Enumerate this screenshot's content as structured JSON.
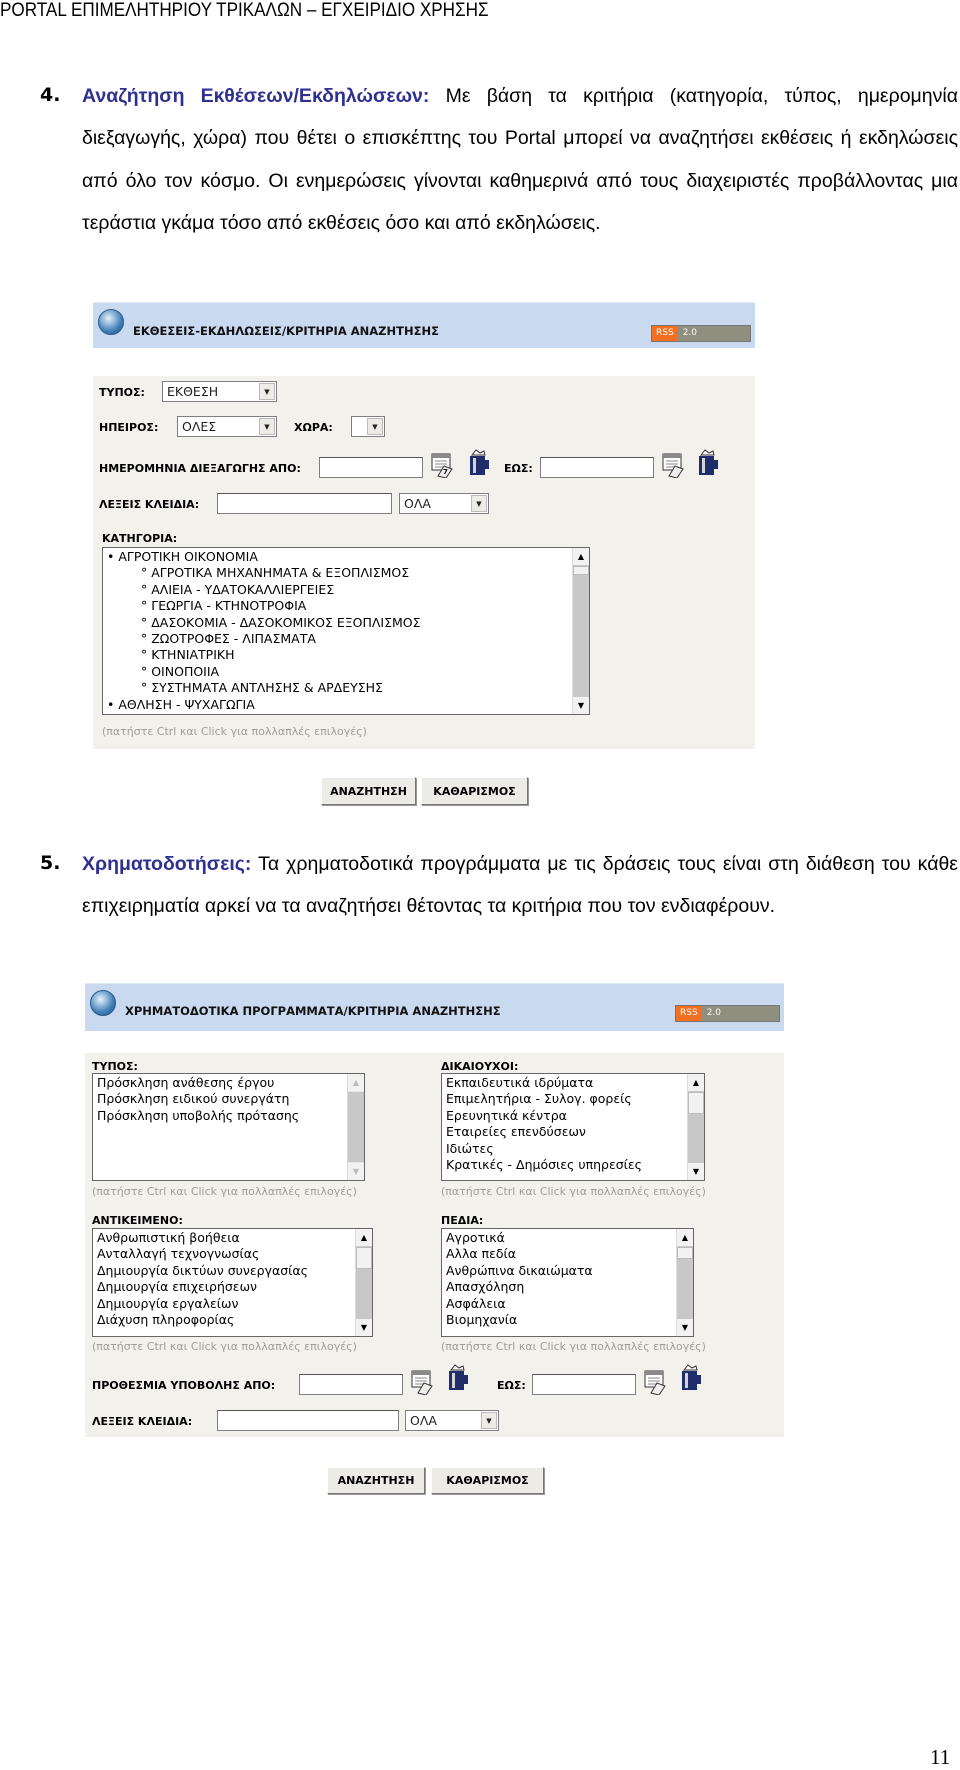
{
  "header": {
    "title": "PORTAL ΕΠΙΜΕΛΗΤΗΡΙΟΥ ΤΡΙΚΑΛΩΝ – ΕΓΧΕΙΡΙΔΙΟ ΧΡΗΣΗΣ"
  },
  "section4": {
    "number": "4.",
    "title": "Αναζήτηση Εκθέσεων/Εκδηλώσεων:",
    "text": " Με βάση τα κριτήρια (κατηγορία, τύπος, ημερομηνία διεξαγωγής, χώρα) που θέτει ο επισκέπτης του Portal μπορεί να αναζητήσει εκθέσεις ή εκδηλώσεις από όλο τον κόσμο. Οι ενημερώσεις γίνονται καθημερινά από τους διαχειριστές προβάλλοντας μια τεράστια γκάμα τόσο από εκθέσεις όσο και από εκδηλώσεις."
  },
  "panel1": {
    "title": "ΕΚΘΕΣΕΙΣ-ΕΚΔΗΛΩΣΕΙΣ/ΚΡΙΤΗΡΙΑ ΑΝΑΖΗΤΗΣΗΣ",
    "rss": {
      "a": "RSS",
      "b": "2.0"
    },
    "type_label": "ΤΥΠΟΣ:",
    "type_value": "ΕΚΘΕΣΗ",
    "continent_label": "ΗΠΕΙΡΟΣ:",
    "continent_value": "ΟΛΕΣ",
    "country_label": "ΧΩΡΑ:",
    "country_value": "",
    "date_from_label": "ΗΜΕΡΟΜΗΝΙΑ ΔΙΕΞΑΓΩΓΗΣ ΑΠΟ:",
    "date_to_label": "ΕΩΣ:",
    "keywords_label": "ΛΕΞΕΙΣ ΚΛΕΙΔΙΑ:",
    "keywords_mode": "ΟΛΑ",
    "category_label": "ΚΑΤΗΓΟΡΙΑ:",
    "categories": [
      {
        "label": "• ΑΓΡΟΤΙΚΗ ΟΙΚΟΝΟΜΙΑ",
        "sub": false
      },
      {
        "label": "° ΑΓΡΟΤΙΚΑ ΜΗΧΑΝΗΜΑΤΑ & ΕΞΟΠΛΙΣΜΟΣ",
        "sub": true
      },
      {
        "label": "° ΑΛΙΕΙΑ - ΥΔΑΤΟΚΑΛΛΙΕΡΓΕΙΕΣ",
        "sub": true
      },
      {
        "label": "° ΓΕΩΡΓΙΑ - ΚΤΗΝΟΤΡΟΦΙΑ",
        "sub": true
      },
      {
        "label": "° ΔΑΣΟΚΟΜΙΑ - ΔΑΣΟΚΟΜΙΚΟΣ ΕΞΟΠΛΙΣΜΟΣ",
        "sub": true
      },
      {
        "label": "° ΖΩΟΤΡΟΦΕΣ - ΛΙΠΑΣΜΑΤΑ",
        "sub": true
      },
      {
        "label": "° ΚΤΗΝΙΑΤΡΙΚΗ",
        "sub": true
      },
      {
        "label": "° ΟΙΝΟΠΟΙΙΑ",
        "sub": true
      },
      {
        "label": "° ΣΥΣΤΗΜΑΤΑ ΑΝΤΛΗΣΗΣ & ΑΡΔΕΥΣΗΣ",
        "sub": true
      },
      {
        "label": "• ΑΘΛΗΣΗ - ΨΥΧΑΓΩΓΙΑ",
        "sub": false
      }
    ],
    "hint": "(πατήστε Ctrl και Click για πολλαπλές επιλογές)",
    "search_button": "ΑΝΑΖΗΤΗΣΗ",
    "clear_button": "ΚΑΘΑΡΙΣΜΟΣ"
  },
  "section5": {
    "number": "5.",
    "title": "Χρηματοδοτήσεις:",
    "text": " Τα χρηματοδοτικά προγράμματα με τις δράσεις τους είναι στη διάθεση του κάθε επιχειρηματία αρκεί να τα αναζητήσει θέτοντας τα κριτήρια που τον ενδιαφέρουν."
  },
  "panel2": {
    "title": "ΧΡΗΜΑΤΟΔΟΤΙΚΑ ΠΡΟΓΡΑΜΜΑΤΑ/ΚΡΙΤΗΡΙΑ ΑΝΑΖΗΤΗΣΗΣ",
    "rss": {
      "a": "RSS",
      "b": "2.0"
    },
    "type_label": "ΤΥΠΟΣ:",
    "types": [
      "Πρόσκληση ανάθεσης έργου",
      "Πρόσκληση ειδικού συνεργάτη",
      "Πρόσκληση υποβολής πρότασης"
    ],
    "beneficiaries_label": "ΔΙΚΑΙΟΥΧΟΙ:",
    "beneficiaries": [
      "Εκπαιδευτικά ιδρύματα",
      "Επιμελητήρια - Συλογ. φορείς",
      "Ερευνητικά κέντρα",
      "Εταιρείες επενδύσεων",
      "Ιδιώτες",
      "Κρατικές - Δημόσιες υπηρεσίες"
    ],
    "subject_label": "ΑΝΤΙΚΕΙΜΕΝΟ:",
    "subjects": [
      "Ανθρωπιστική βοήθεια",
      "Ανταλλαγή τεχνογνωσίας",
      "Δημιουργία δικτύων συνεργασίας",
      "Δημιουργία επιχειρήσεων",
      "Δημιουργία εργαλείων",
      "Διάχυση πληροφορίας"
    ],
    "fields_label": "ΠΕΔΙΑ:",
    "fields": [
      "Αγροτικά",
      "Αλλα πεδία",
      "Ανθρώπινα δικαιώματα",
      "Απασχόληση",
      "Ασφάλεια",
      "Βιομηχανία"
    ],
    "hint": "(πατήστε Ctrl και Click για πολλαπλές επιλογές)",
    "deadline_from_label": "ΠΡΟΘΕΣΜΙΑ ΥΠΟΒΟΛΗΣ ΑΠΟ:",
    "deadline_to_label": "ΕΩΣ:",
    "keywords_label": "ΛΕΞΕΙΣ ΚΛΕΙΔΙΑ:",
    "keywords_mode": "ΟΛΑ",
    "search_button": "ΑΝΑΖΗΤΗΣΗ",
    "clear_button": "ΚΑΘΑΡΙΣΜΟΣ"
  },
  "page_number": "11"
}
